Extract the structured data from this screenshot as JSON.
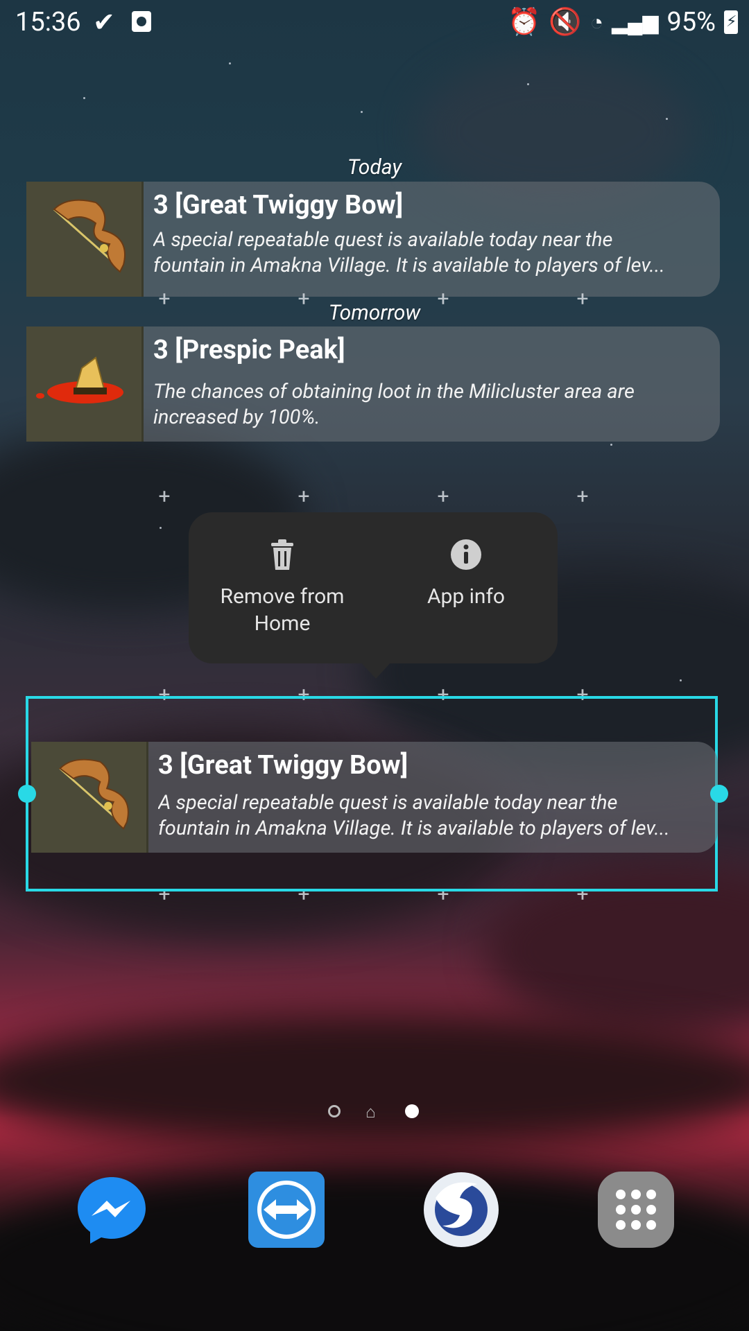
{
  "status_bar": {
    "time": "15:36",
    "battery": "95%"
  },
  "widget_list": {
    "today_label": "Today",
    "tomorrow_label": "Tomorrow",
    "items": [
      {
        "title": "3 [Great Twiggy Bow]",
        "description_line1": "A special repeatable quest is available today near the",
        "description_line2": "fountain in Amakna Village. It is available to players of lev..."
      },
      {
        "title": "3 [Prespic Peak]",
        "description_line1": "The chances of obtaining loot in the Milicluster area are",
        "description_line2": "increased by 100%."
      }
    ]
  },
  "context_menu": {
    "remove_label": "Remove from Home",
    "remove_line1": "Remove from",
    "remove_line2": "Home",
    "app_info_label": "App info"
  },
  "selected_widget": {
    "title": "3 [Great Twiggy Bow]",
    "description_line1": "A special repeatable quest is available today near the",
    "description_line2": "fountain in Amakna Village. It is available to players of lev..."
  },
  "dock": {
    "apps": [
      "messenger-icon",
      "teamviewer-icon",
      "waterfox-icon",
      "app-drawer-icon"
    ]
  },
  "colors": {
    "accent": "#29d9e6",
    "popup_bg": "#2a2a2a"
  }
}
